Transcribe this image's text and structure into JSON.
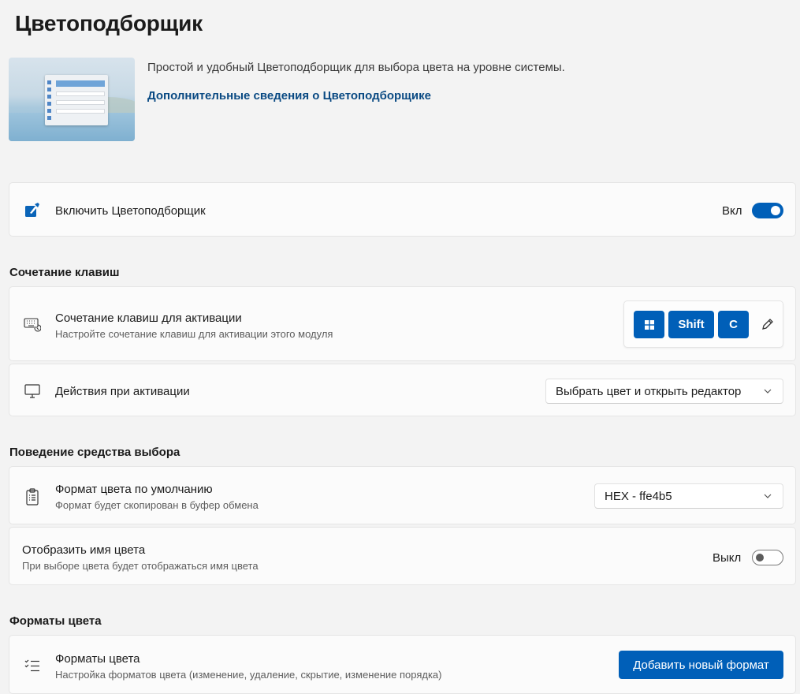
{
  "page": {
    "title": "Цветоподборщик"
  },
  "hero": {
    "description": "Простой и удобный Цветоподборщик для выбора цвета на уровне системы.",
    "link": "Дополнительные сведения о Цветоподборщике"
  },
  "enable": {
    "label": "Включить Цветоподборщик",
    "state_label": "Вкл",
    "state": true,
    "icon": "color-picker-icon"
  },
  "shortcut_section": {
    "heading": "Сочетание клавиш",
    "activation_shortcut": {
      "title": "Сочетание клавиш для активации",
      "subtitle": "Настройте сочетание клавиш для активации этого модуля",
      "icon": "keyboard-icon",
      "keys": [
        "windows-key",
        "Shift",
        "C"
      ]
    },
    "activation_action": {
      "title": "Действия при активации",
      "icon": "monitor-icon",
      "selected": "Выбрать цвет и открыть редактор"
    }
  },
  "picker_section": {
    "heading": "Поведение средства выбора",
    "default_format": {
      "title": "Формат цвета по умолчанию",
      "subtitle": "Формат будет скопирован в буфер обмена",
      "icon": "clipboard-icon",
      "selected": "HEX - ffe4b5"
    },
    "show_color_name": {
      "title": "Отобразить имя цвета",
      "subtitle": "При выборе цвета будет отображаться имя цвета",
      "state_label": "Выкл",
      "state": false
    }
  },
  "formats_section": {
    "heading": "Форматы цвета",
    "formats": {
      "title": "Форматы цвета",
      "subtitle": "Настройка форматов цвета (изменение, удаление, скрытие, изменение порядка)",
      "icon": "checklist-icon",
      "button": "Добавить новый формат"
    }
  },
  "colors": {
    "accent": "#005fb8",
    "link": "#0a4a83",
    "background": "#f3f3f3",
    "card": "#fbfbfb"
  }
}
